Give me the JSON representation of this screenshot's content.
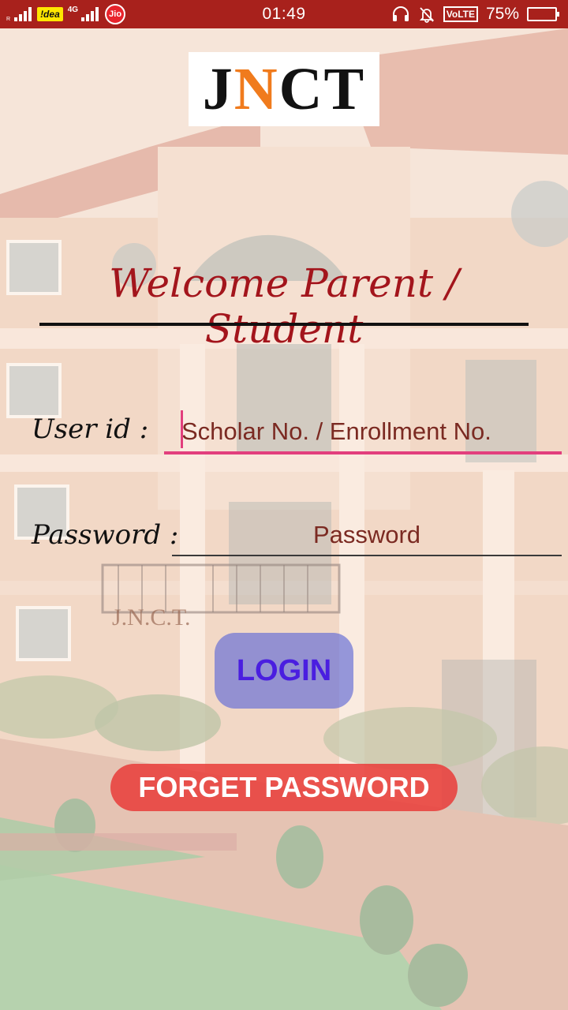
{
  "status_bar": {
    "carrier1": "!dea",
    "network_type": "4G",
    "carrier2": "Jio",
    "time": "01:49",
    "volte": "VoLTE",
    "battery_percent": "75%",
    "battery_level": 0.75
  },
  "logo": {
    "letters": [
      "J",
      "N",
      "C",
      "T"
    ],
    "accent_color": "#f07b1d"
  },
  "background_sign": "J.N.C.T.",
  "welcome": {
    "title": "Welcome Parent / Student"
  },
  "form": {
    "user_label": "User id :",
    "user_placeholder": "Scholar No. / Enrollment No.",
    "password_label": "Password :",
    "password_placeholder": "Password",
    "login_label": "LOGIN",
    "forget_label": "FORGET PASSWORD"
  },
  "colors": {
    "status_bar": "#a8211c",
    "title": "#a3151c",
    "focus_underline": "#e23f7d",
    "login_text": "#4a1ee0",
    "forget_button": "#e8403c"
  }
}
